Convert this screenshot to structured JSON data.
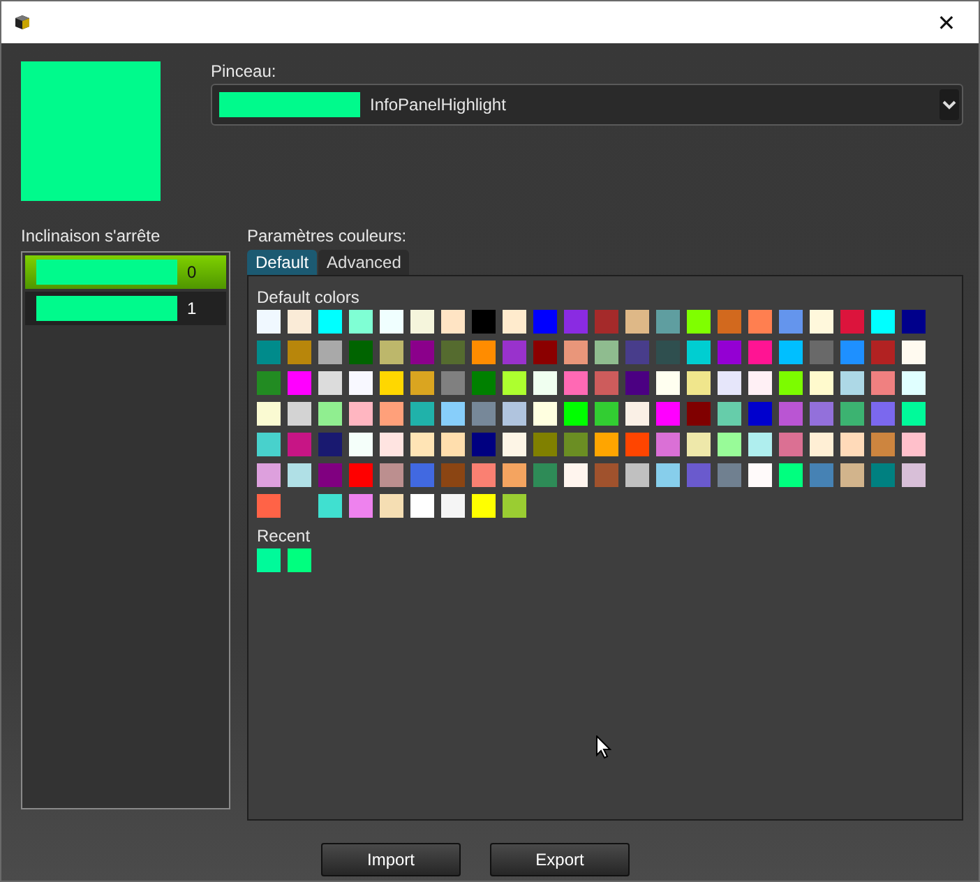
{
  "window": {
    "close": "✕"
  },
  "preview": {
    "color": "#00fa8c"
  },
  "brush": {
    "label": "Pinceau:",
    "value": "InfoPanelHighlight",
    "color": "#00fa8c"
  },
  "gradient_stops": {
    "label": "Inclinaison s'arrête",
    "items": [
      {
        "label": "0",
        "color": "#00fa8c",
        "selected": true
      },
      {
        "label": "1",
        "color": "#00fa8c",
        "selected": false
      }
    ]
  },
  "color_settings": {
    "label": "Paramètres couleurs:",
    "tabs": [
      {
        "label": "Default",
        "selected": true
      },
      {
        "label": "Advanced",
        "selected": false
      }
    ],
    "default_colors_label": "Default colors",
    "default_colors": [
      [
        {
          "kind": "solid",
          "color": "#f0f8ff"
        },
        {
          "kind": "solid",
          "color": "#faebd7"
        },
        {
          "kind": "solid",
          "color": "#00ffff"
        },
        {
          "kind": "solid",
          "color": "#7fffd4"
        },
        {
          "kind": "solid",
          "color": "#f0ffff"
        },
        {
          "kind": "solid",
          "color": "#f5f5dc"
        },
        {
          "kind": "solid",
          "color": "#ffe4c4"
        },
        {
          "kind": "solid",
          "color": "#000000"
        },
        {
          "kind": "solid",
          "color": "#ffebcd"
        },
        {
          "kind": "solid",
          "color": "#0000ff"
        },
        {
          "kind": "solid",
          "color": "#8a2be2"
        },
        {
          "kind": "solid",
          "color": "#a52a2a"
        },
        {
          "kind": "solid",
          "color": "#deb887"
        },
        {
          "kind": "solid",
          "color": "#5f9ea0"
        },
        {
          "kind": "solid",
          "color": "#7fff00"
        },
        {
          "kind": "solid",
          "color": "#d2691e"
        },
        {
          "kind": "solid",
          "color": "#ff7f50"
        },
        {
          "kind": "solid",
          "color": "#6495ed"
        },
        {
          "kind": "solid",
          "color": "#fff8dc"
        },
        {
          "kind": "solid",
          "color": "#dc143c"
        },
        {
          "kind": "solid",
          "color": "#00ffff"
        },
        {
          "kind": "solid",
          "color": "#00008b"
        }
      ],
      [
        {
          "kind": "solid",
          "color": "#008b8b"
        },
        {
          "kind": "solid",
          "color": "#b8860b"
        },
        {
          "kind": "solid",
          "color": "#a9a9a9"
        },
        {
          "kind": "solid",
          "color": "#006400"
        },
        {
          "kind": "solid",
          "color": "#bdb76b"
        },
        {
          "kind": "solid",
          "color": "#8b008b"
        },
        {
          "kind": "solid",
          "color": "#556b2f"
        },
        {
          "kind": "solid",
          "color": "#ff8c00"
        },
        {
          "kind": "solid",
          "color": "#9932cc"
        },
        {
          "kind": "solid",
          "color": "#8b0000"
        },
        {
          "kind": "solid",
          "color": "#e9967a"
        },
        {
          "kind": "solid",
          "color": "#8fbc8f"
        },
        {
          "kind": "solid",
          "color": "#483d8b"
        },
        {
          "kind": "solid",
          "color": "#2f4f4f"
        },
        {
          "kind": "solid",
          "color": "#00ced1"
        },
        {
          "kind": "solid",
          "color": "#9400d3"
        },
        {
          "kind": "solid",
          "color": "#ff1493"
        },
        {
          "kind": "solid",
          "color": "#00bfff"
        },
        {
          "kind": "solid",
          "color": "#696969"
        },
        {
          "kind": "solid",
          "color": "#1e90ff"
        },
        {
          "kind": "solid",
          "color": "#b22222"
        },
        {
          "kind": "solid",
          "color": "#fffaf0"
        }
      ],
      [
        {
          "kind": "solid",
          "color": "#228b22"
        },
        {
          "kind": "solid",
          "color": "#ff00ff"
        },
        {
          "kind": "solid",
          "color": "#dcdcdc"
        },
        {
          "kind": "solid",
          "color": "#f8f8ff"
        },
        {
          "kind": "solid",
          "color": "#ffd700"
        },
        {
          "kind": "solid",
          "color": "#daa520"
        },
        {
          "kind": "solid",
          "color": "#808080"
        },
        {
          "kind": "solid",
          "color": "#008000"
        },
        {
          "kind": "solid",
          "color": "#adff2f"
        },
        {
          "kind": "solid",
          "color": "#f0fff0"
        },
        {
          "kind": "solid",
          "color": "#ff69b4"
        },
        {
          "kind": "solid",
          "color": "#cd5c5c"
        },
        {
          "kind": "solid",
          "color": "#4b0082"
        },
        {
          "kind": "solid",
          "color": "#fffff0"
        },
        {
          "kind": "solid",
          "color": "#f0e68c"
        },
        {
          "kind": "solid",
          "color": "#e6e6fa"
        },
        {
          "kind": "solid",
          "color": "#fff0f5"
        },
        {
          "kind": "solid",
          "color": "#7cfc00"
        },
        {
          "kind": "solid",
          "color": "#fffacd"
        },
        {
          "kind": "solid",
          "color": "#add8e6"
        },
        {
          "kind": "solid",
          "color": "#f08080"
        },
        {
          "kind": "solid",
          "color": "#e0ffff"
        }
      ],
      [
        {
          "kind": "solid",
          "color": "#fafad2"
        },
        {
          "kind": "solid",
          "color": "#d3d3d3"
        },
        {
          "kind": "solid",
          "color": "#90ee90"
        },
        {
          "kind": "solid",
          "color": "#ffb6c1"
        },
        {
          "kind": "solid",
          "color": "#ffa07a"
        },
        {
          "kind": "solid",
          "color": "#20b2aa"
        },
        {
          "kind": "solid",
          "color": "#87cefa"
        },
        {
          "kind": "solid",
          "color": "#778899"
        },
        {
          "kind": "solid",
          "color": "#b0c4de"
        },
        {
          "kind": "solid",
          "color": "#ffffe0"
        },
        {
          "kind": "solid",
          "color": "#00ff00"
        },
        {
          "kind": "solid",
          "color": "#32cd32"
        },
        {
          "kind": "solid",
          "color": "#faf0e6"
        },
        {
          "kind": "solid",
          "color": "#ff00ff"
        },
        {
          "kind": "solid",
          "color": "#800000"
        },
        {
          "kind": "solid",
          "color": "#66cdaa"
        },
        {
          "kind": "solid",
          "color": "#0000cd"
        },
        {
          "kind": "solid",
          "color": "#ba55d3"
        },
        {
          "kind": "solid",
          "color": "#9370db"
        },
        {
          "kind": "solid",
          "color": "#3cb371"
        },
        {
          "kind": "solid",
          "color": "#7b68ee"
        },
        {
          "kind": "solid",
          "color": "#00fa9a"
        }
      ],
      [
        {
          "kind": "solid",
          "color": "#48d1cc"
        },
        {
          "kind": "solid",
          "color": "#c71585"
        },
        {
          "kind": "solid",
          "color": "#191970"
        },
        {
          "kind": "solid",
          "color": "#f5fffa"
        },
        {
          "kind": "solid",
          "color": "#ffe4e1"
        },
        {
          "kind": "solid",
          "color": "#ffe4b5"
        },
        {
          "kind": "solid",
          "color": "#ffdead"
        },
        {
          "kind": "solid",
          "color": "#000080"
        },
        {
          "kind": "solid",
          "color": "#fdf5e6"
        },
        {
          "kind": "solid",
          "color": "#808000"
        },
        {
          "kind": "solid",
          "color": "#6b8e23"
        },
        {
          "kind": "solid",
          "color": "#ffa500"
        },
        {
          "kind": "solid",
          "color": "#ff4500"
        },
        {
          "kind": "solid",
          "color": "#da70d6"
        },
        {
          "kind": "solid",
          "color": "#eee8aa"
        },
        {
          "kind": "solid",
          "color": "#98fb98"
        },
        {
          "kind": "solid",
          "color": "#afeeee"
        },
        {
          "kind": "solid",
          "color": "#db7093"
        },
        {
          "kind": "solid",
          "color": "#ffefd5"
        },
        {
          "kind": "solid",
          "color": "#ffdab9"
        },
        {
          "kind": "solid",
          "color": "#cd853f"
        },
        {
          "kind": "solid",
          "color": "#ffc0cb"
        }
      ],
      [
        {
          "kind": "solid",
          "color": "#dda0dd"
        },
        {
          "kind": "solid",
          "color": "#b0e0e6"
        },
        {
          "kind": "solid",
          "color": "#800080"
        },
        {
          "kind": "solid",
          "color": "#ff0000"
        },
        {
          "kind": "solid",
          "color": "#bc8f8f"
        },
        {
          "kind": "solid",
          "color": "#4169e1"
        },
        {
          "kind": "solid",
          "color": "#8b4513"
        },
        {
          "kind": "solid",
          "color": "#fa8072"
        },
        {
          "kind": "solid",
          "color": "#f4a460"
        },
        {
          "kind": "solid",
          "color": "#2e8b57"
        },
        {
          "kind": "solid",
          "color": "#fff5ee"
        },
        {
          "kind": "solid",
          "color": "#a0522d"
        },
        {
          "kind": "solid",
          "color": "#c0c0c0"
        },
        {
          "kind": "solid",
          "color": "#87ceeb"
        },
        {
          "kind": "solid",
          "color": "#6a5acd"
        },
        {
          "kind": "solid",
          "color": "#708090"
        },
        {
          "kind": "solid",
          "color": "#fffafa"
        },
        {
          "kind": "solid",
          "color": "#00ff7f"
        },
        {
          "kind": "solid",
          "color": "#4682b4"
        },
        {
          "kind": "solid",
          "color": "#d2b48c"
        },
        {
          "kind": "solid",
          "color": "#008080"
        },
        {
          "kind": "solid",
          "color": "#d8bfd8"
        }
      ],
      [
        {
          "kind": "solid",
          "color": "#ff6347"
        },
        {
          "kind": "transparent"
        },
        {
          "kind": "solid",
          "color": "#40e0d0"
        },
        {
          "kind": "solid",
          "color": "#ee82ee"
        },
        {
          "kind": "solid",
          "color": "#f5deb3"
        },
        {
          "kind": "solid",
          "color": "#ffffff"
        },
        {
          "kind": "solid",
          "color": "#f5f5f5"
        },
        {
          "kind": "solid",
          "color": "#ffff00"
        },
        {
          "kind": "solid",
          "color": "#9acd32"
        }
      ]
    ],
    "recent_label": "Recent",
    "recent_colors": [
      {
        "color": "#00fa9a"
      },
      {
        "color": "#00ff7f"
      }
    ]
  },
  "buttons": [
    {
      "label": "Import"
    },
    {
      "label": "Export"
    }
  ]
}
